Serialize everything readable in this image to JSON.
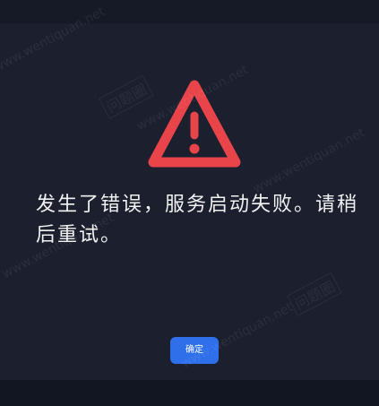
{
  "dialog": {
    "message": "发生了错误，服务启动失败。请稍后重试。",
    "confirm_label": "确定"
  },
  "watermark": {
    "text": "www.wentiquan.net",
    "logo_text": "问题圈"
  },
  "colors": {
    "background": "#1b1f2e",
    "warning": "#e8444a",
    "button": "#2f6fea",
    "text": "#f2f2f2"
  },
  "icons": {
    "warning": "warning-triangle-icon"
  }
}
